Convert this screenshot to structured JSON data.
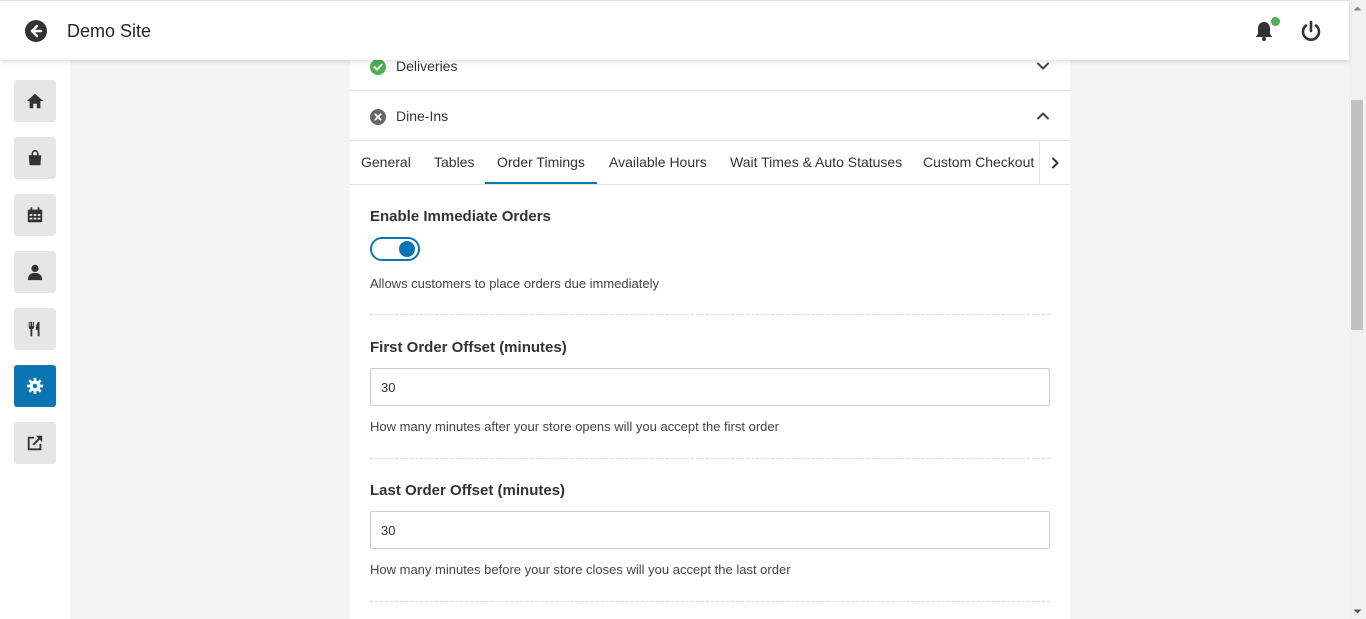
{
  "header": {
    "title": "Demo Site",
    "back_icon": "arrow-left-circle-icon",
    "bell_icon": "bell-icon",
    "power_icon": "power-icon",
    "notification_dot_color": "#4caf50"
  },
  "sidebar": {
    "items": [
      {
        "icon": "home-icon",
        "active": false
      },
      {
        "icon": "shopping-bag-icon",
        "active": false
      },
      {
        "icon": "calendar-icon",
        "active": false
      },
      {
        "icon": "user-icon",
        "active": false
      },
      {
        "icon": "utensils-icon",
        "active": false
      },
      {
        "icon": "gear-icon",
        "active": true
      },
      {
        "icon": "external-link-icon",
        "active": false
      }
    ],
    "accent_color": "#0b74b3"
  },
  "accordion": {
    "deliveries": {
      "label": "Deliveries",
      "status": "enabled",
      "status_color": "#4caf50",
      "expanded": false
    },
    "dine_ins": {
      "label": "Dine-Ins",
      "status": "disabled",
      "status_color": "#666666",
      "expanded": true
    }
  },
  "tabs": {
    "items": [
      "General",
      "Tables",
      "Order Timings",
      "Available Hours",
      "Wait Times & Auto Statuses",
      "Custom Checkout F"
    ],
    "active": "Order Timings"
  },
  "settings": {
    "immediate": {
      "title": "Enable Immediate Orders",
      "enabled": true,
      "help": "Allows customers to place orders due immediately"
    },
    "first_offset": {
      "title": "First Order Offset (minutes)",
      "value": "30",
      "help": "How many minutes after your store opens will you accept the first order"
    },
    "last_offset": {
      "title": "Last Order Offset (minutes)",
      "value": "30",
      "help": "How many minutes before your store closes will you accept the last order"
    }
  }
}
